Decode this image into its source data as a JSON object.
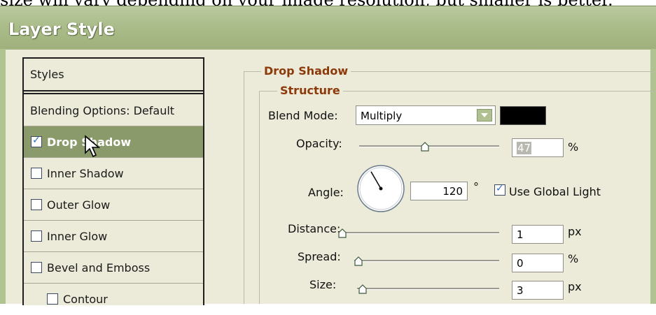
{
  "caption": "size will vary depending on your image resolution, but smaller is better.",
  "dialog": {
    "title": "Layer Style"
  },
  "styles_list": {
    "header": "Styles",
    "items": [
      {
        "label": "Blending Options: Default",
        "has_checkbox": false,
        "checked": false,
        "selected": false
      },
      {
        "label": "Drop Shadow",
        "has_checkbox": true,
        "checked": true,
        "selected": true
      },
      {
        "label": "Inner Shadow",
        "has_checkbox": true,
        "checked": false,
        "selected": false
      },
      {
        "label": "Outer Glow",
        "has_checkbox": true,
        "checked": false,
        "selected": false
      },
      {
        "label": "Inner Glow",
        "has_checkbox": true,
        "checked": false,
        "selected": false
      },
      {
        "label": "Bevel and Emboss",
        "has_checkbox": true,
        "checked": false,
        "selected": false
      },
      {
        "label": "Contour",
        "has_checkbox": true,
        "checked": false,
        "selected": false
      }
    ]
  },
  "panel": {
    "group_title": "Drop Shadow",
    "subgroup_title": "Structure",
    "blend_mode": {
      "label": "Blend Mode:",
      "value": "Multiply",
      "color": "#000000"
    },
    "opacity": {
      "label": "Opacity:",
      "value": "47",
      "unit": "%",
      "level": 0.47
    },
    "angle": {
      "label": "Angle:",
      "value": "120",
      "unit": "°",
      "degrees": 120
    },
    "use_global_light": {
      "label": "Use Global Light",
      "checked": true
    },
    "distance": {
      "label": "Distance:",
      "value": "1",
      "unit": "px",
      "level": 0.0
    },
    "spread": {
      "label": "Spread:",
      "value": "0",
      "unit": "%",
      "level": 0.0
    },
    "size": {
      "label": "Size:",
      "value": "3",
      "unit": "px",
      "level": 0.01
    }
  },
  "icons": {
    "cursor": "arrow-cursor-icon",
    "dropdown": "chevron-down-icon",
    "checkbox": "checkmark-icon"
  },
  "colors": {
    "titlebar": "#a8ba86",
    "selected_row": "#8a9a6a",
    "group_label": "#8c3a0a",
    "dialog_bg": "#ecead8"
  }
}
